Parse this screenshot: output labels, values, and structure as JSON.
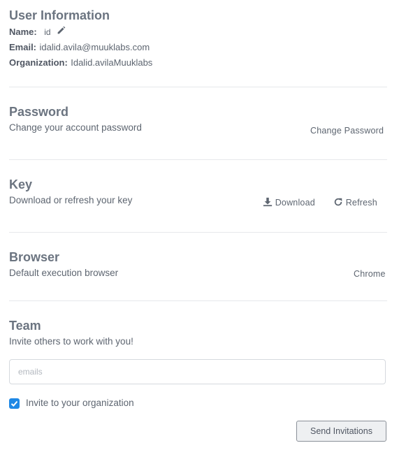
{
  "user_info": {
    "title": "User Information",
    "name_label": "Name:",
    "name_value": "id",
    "email_label": "Email:",
    "email_value": "idalid.avila@muuklabs.com",
    "org_label": "Organization:",
    "org_value": "Idalid.avilaMuuklabs"
  },
  "password": {
    "title": "Password",
    "description": "Change your account password",
    "action": "Change Password"
  },
  "key": {
    "title": "Key",
    "description": "Download or refresh your key",
    "download": "Download",
    "refresh": "Refresh"
  },
  "browser": {
    "title": "Browser",
    "description": "Default execution browser",
    "value": "Chrome"
  },
  "team": {
    "title": "Team",
    "description": "Invite others to work with you!",
    "emails_placeholder": "emails",
    "invite_checkbox_label": "Invite to your organization",
    "invite_checked": true,
    "send_button": "Send Invitations"
  },
  "colors": {
    "checkbox": "#1e88e5"
  }
}
